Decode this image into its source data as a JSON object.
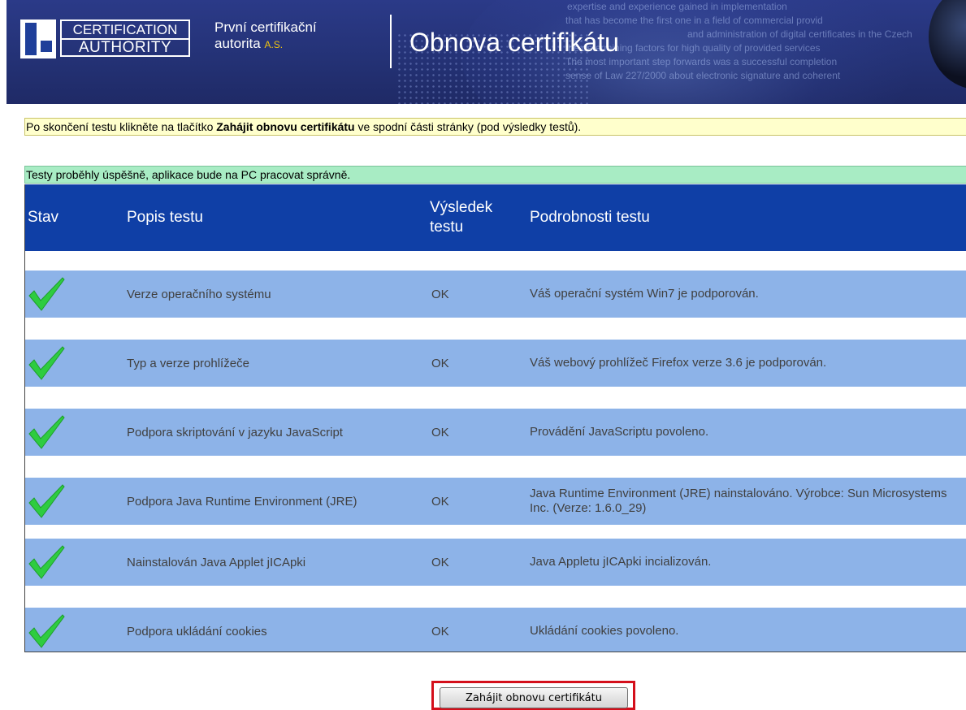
{
  "header": {
    "ca_line1": "CERTIFICATION",
    "ca_line2": "AUTHORITY",
    "org_line1": "První certifikační",
    "org_line2": "autorita",
    "org_suffix": "A.S.",
    "title": "Obnova certifikátu",
    "bg_text": [
      "expertise and experience gained in implementation",
      "that has become the first one in a field of commercial provid",
      "and administration of digital certificates in the Czech",
      "the determining factors for high quality of provided services",
      "The most important step forwards was a successful completion",
      "sense of Law 227/2000 about electronic signature and coherent"
    ]
  },
  "notice_info": {
    "before": "Po skončení testu klikněte na tlačítko ",
    "bold": "Zahájit obnovu certifikátu",
    "after": " ve spodní části stránky (pod výsledky testů)."
  },
  "notice_success": "Testy proběhly úspěšně, aplikace bude na PC pracovat správně.",
  "table": {
    "headers": {
      "stav": "Stav",
      "popis": "Popis testu",
      "vysledek_1": "Výsledek",
      "vysledek_2": "testu",
      "podrobnosti": "Podrobnosti testu"
    },
    "rows": [
      {
        "status_icon": "check-icon",
        "popis": "Verze operačního systému",
        "vysledek": "OK",
        "podrobnosti": "Váš operační systém Win7 je podporován."
      },
      {
        "status_icon": "check-icon",
        "popis": "Typ a verze prohlížeče",
        "vysledek": "OK",
        "podrobnosti": "Váš webový prohlížeč Firefox verze 3.6 je podporován."
      },
      {
        "status_icon": "check-icon",
        "popis": "Podpora skriptování v jazyku JavaScript",
        "vysledek": "OK",
        "podrobnosti": "Provádění JavaScriptu povoleno."
      },
      {
        "status_icon": "check-icon",
        "popis": "Podpora Java Runtime Environment (JRE)",
        "vysledek": "OK",
        "podrobnosti": "Java Runtime Environment (JRE) nainstalováno. Výrobce: Sun Microsystems Inc. (Verze: 1.6.0_29)"
      },
      {
        "status_icon": "check-icon",
        "popis": "Nainstalován Java Applet jICApki",
        "vysledek": "OK",
        "podrobnosti": "Java Appletu jICApki incializován."
      },
      {
        "status_icon": "check-icon",
        "popis": "Podpora ukládání cookies",
        "vysledek": "OK",
        "podrobnosti": "Ukládání cookies povoleno."
      }
    ]
  },
  "button": {
    "label": "Zahájit obnovu certifikátu"
  },
  "colors": {
    "header_bg": "#243276",
    "table_header_bg": "#0f3fa6",
    "row_bg": "#8db3e8",
    "notice_yellow": "#ffffcc",
    "notice_green": "#a8ecc4",
    "highlight_red": "#d40f1b",
    "check_green": "#2ecc40"
  }
}
